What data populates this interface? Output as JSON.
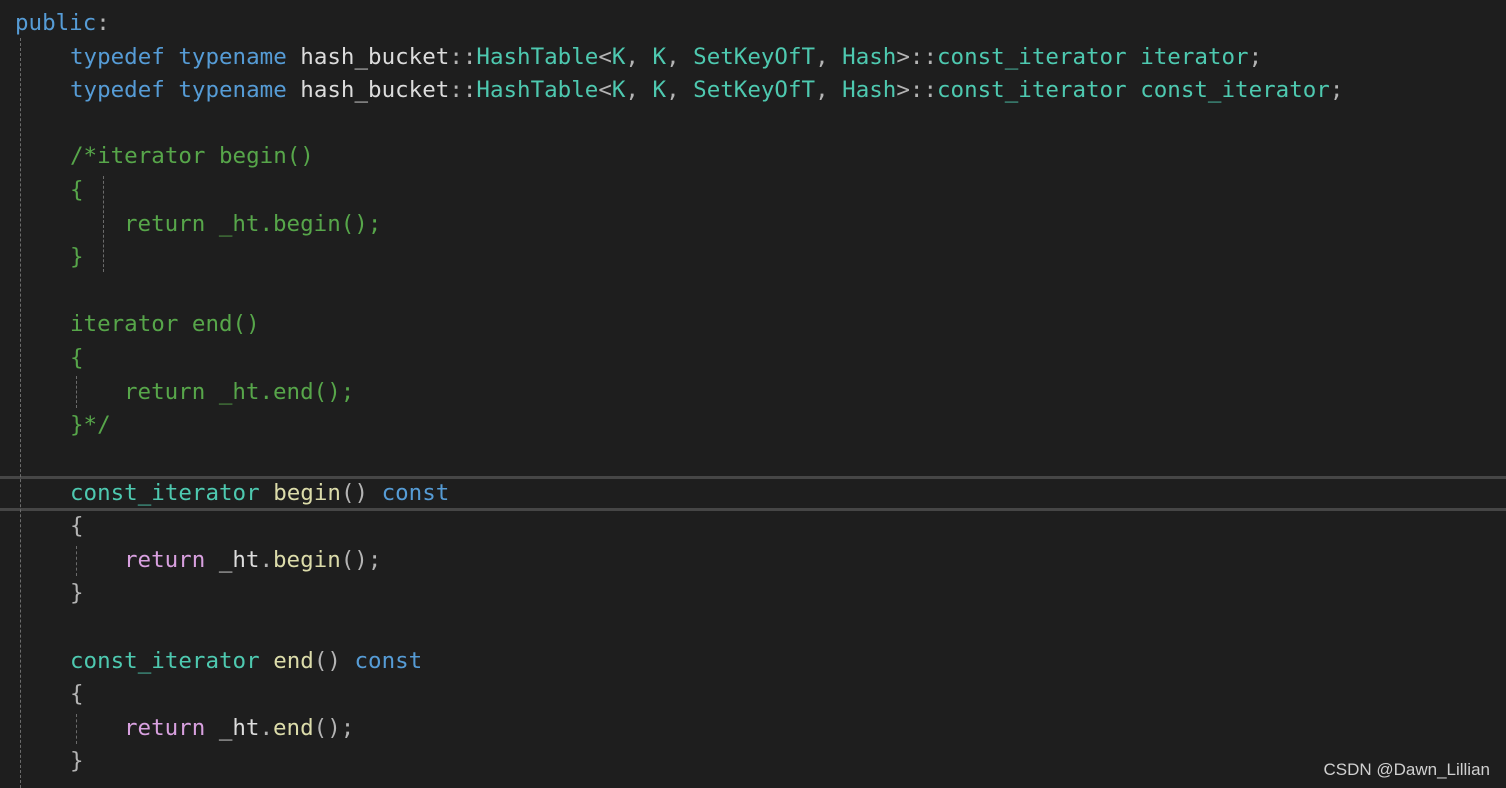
{
  "code_lines": [
    {
      "id": "l1",
      "tokens": [
        [
          "kw",
          "public"
        ],
        [
          "punc",
          ":"
        ]
      ]
    },
    {
      "id": "l2",
      "tokens": [
        [
          "kw",
          "typedef"
        ],
        [
          "ident",
          " "
        ],
        [
          "kw",
          "typename"
        ],
        [
          "ident",
          " hash_bucket"
        ],
        [
          "punc",
          "::"
        ],
        [
          "type",
          "HashTable"
        ],
        [
          "punc",
          "<"
        ],
        [
          "type",
          "K"
        ],
        [
          "punc",
          ", "
        ],
        [
          "type",
          "K"
        ],
        [
          "punc",
          ", "
        ],
        [
          "type",
          "SetKeyOfT"
        ],
        [
          "punc",
          ", "
        ],
        [
          "type",
          "Hash"
        ],
        [
          "punc",
          ">::"
        ],
        [
          "type",
          "const_iterator"
        ],
        [
          "ident",
          " "
        ],
        [
          "type",
          "iterator"
        ],
        [
          "punc",
          ";"
        ]
      ]
    },
    {
      "id": "l3",
      "tokens": [
        [
          "kw",
          "typedef"
        ],
        [
          "ident",
          " "
        ],
        [
          "kw",
          "typename"
        ],
        [
          "ident",
          " hash_bucket"
        ],
        [
          "punc",
          "::"
        ],
        [
          "type",
          "HashTable"
        ],
        [
          "punc",
          "<"
        ],
        [
          "type",
          "K"
        ],
        [
          "punc",
          ", "
        ],
        [
          "type",
          "K"
        ],
        [
          "punc",
          ", "
        ],
        [
          "type",
          "SetKeyOfT"
        ],
        [
          "punc",
          ", "
        ],
        [
          "type",
          "Hash"
        ],
        [
          "punc",
          ">::"
        ],
        [
          "type",
          "const_iterator"
        ],
        [
          "ident",
          " "
        ],
        [
          "type",
          "const_iterator"
        ],
        [
          "punc",
          ";"
        ]
      ]
    },
    {
      "id": "l4",
      "tokens": []
    },
    {
      "id": "l5",
      "tokens": [
        [
          "comment",
          "/*iterator begin()"
        ]
      ]
    },
    {
      "id": "l6",
      "tokens": [
        [
          "comment",
          "{"
        ]
      ]
    },
    {
      "id": "l7",
      "tokens": [
        [
          "comment",
          "return _ht.begin();"
        ]
      ]
    },
    {
      "id": "l8",
      "tokens": [
        [
          "comment",
          "}"
        ]
      ]
    },
    {
      "id": "l9",
      "tokens": []
    },
    {
      "id": "l10",
      "tokens": [
        [
          "comment",
          "iterator end()"
        ]
      ]
    },
    {
      "id": "l11",
      "tokens": [
        [
          "comment",
          "{"
        ]
      ]
    },
    {
      "id": "l12",
      "tokens": [
        [
          "comment",
          "return _ht.end();"
        ]
      ]
    },
    {
      "id": "l13",
      "tokens": [
        [
          "comment",
          "}*/"
        ]
      ]
    },
    {
      "id": "l14",
      "tokens": []
    },
    {
      "id": "l15",
      "tokens": [
        [
          "type",
          "const_iterator"
        ],
        [
          "ident",
          " "
        ],
        [
          "fn",
          "begin"
        ],
        [
          "punc",
          "() "
        ],
        [
          "kw",
          "const"
        ]
      ]
    },
    {
      "id": "l16",
      "tokens": [
        [
          "punc",
          "{"
        ]
      ]
    },
    {
      "id": "l17",
      "tokens": [
        [
          "ctrl",
          "return"
        ],
        [
          "ident",
          " _ht"
        ],
        [
          "punc",
          "."
        ],
        [
          "fn",
          "begin"
        ],
        [
          "punc",
          "();"
        ]
      ]
    },
    {
      "id": "l18",
      "tokens": [
        [
          "punc",
          "}"
        ]
      ]
    },
    {
      "id": "l19",
      "tokens": []
    },
    {
      "id": "l20",
      "tokens": [
        [
          "type",
          "const_iterator"
        ],
        [
          "ident",
          " "
        ],
        [
          "fn",
          "end"
        ],
        [
          "punc",
          "() "
        ],
        [
          "kw",
          "const"
        ]
      ]
    },
    {
      "id": "l21",
      "tokens": [
        [
          "punc",
          "{"
        ]
      ]
    },
    {
      "id": "l22",
      "tokens": [
        [
          "ctrl",
          "return"
        ],
        [
          "ident",
          " _ht"
        ],
        [
          "punc",
          "."
        ],
        [
          "fn",
          "end"
        ],
        [
          "punc",
          "();"
        ]
      ]
    },
    {
      "id": "l23",
      "tokens": [
        [
          "punc",
          "}"
        ]
      ]
    }
  ],
  "watermark": "CSDN @Dawn_Lillian",
  "colors": {
    "background": "#1e1e1e",
    "keyword": "#569cd6",
    "type": "#4ec9b0",
    "function": "#dcdcaa",
    "control": "#d8a0df",
    "comment": "#57a64a",
    "identifier": "#dcdcdc"
  }
}
